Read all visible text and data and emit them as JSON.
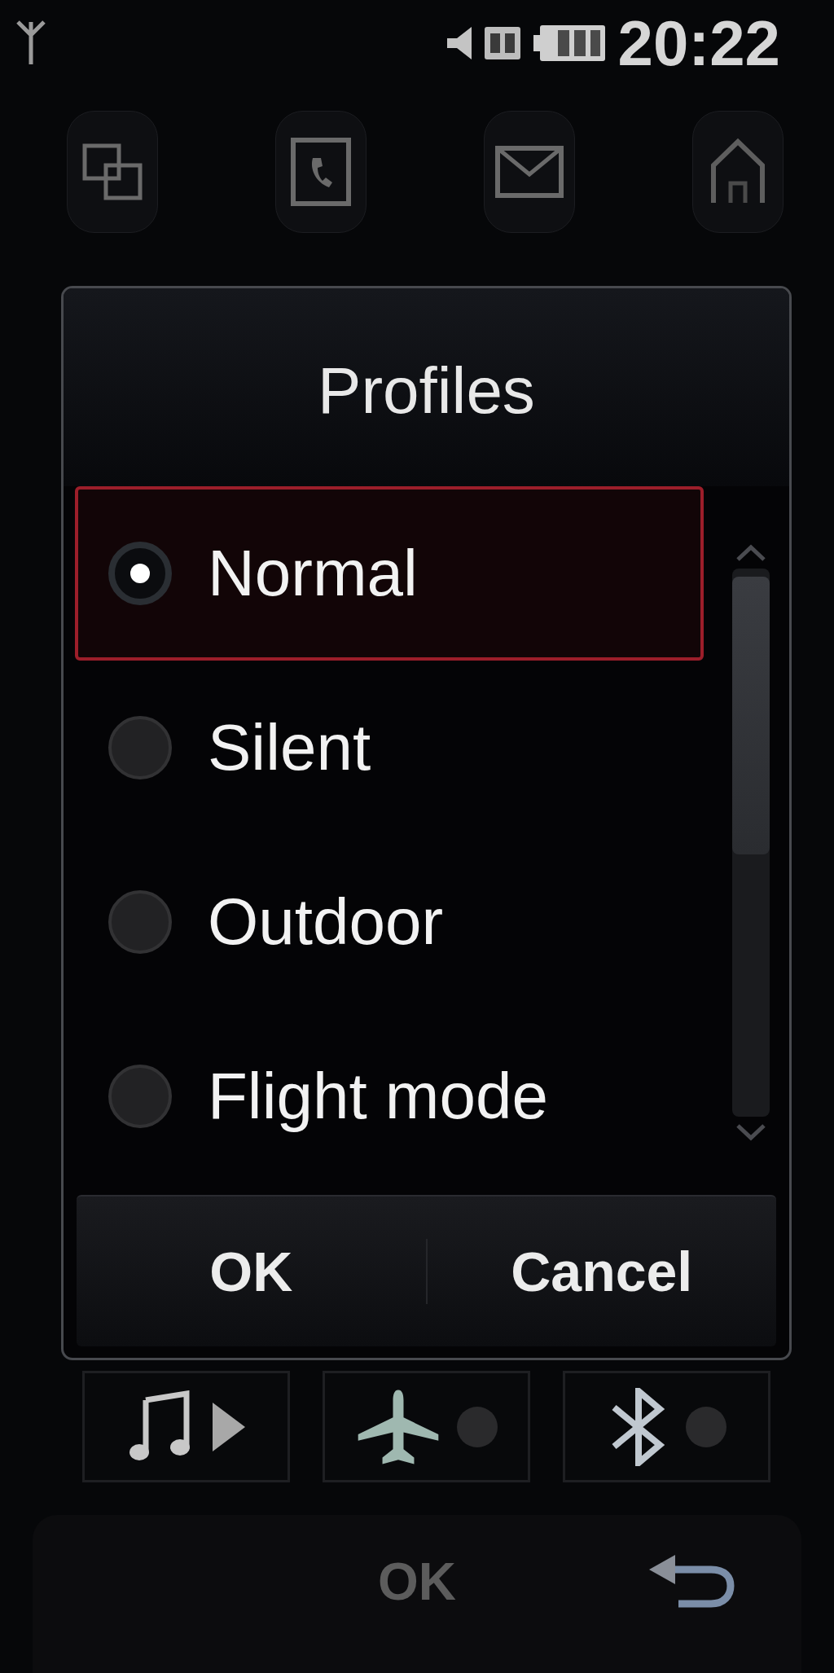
{
  "status_bar": {
    "time": "20:22"
  },
  "dialog": {
    "title": "Profiles",
    "options": [
      {
        "label": "Normal",
        "selected": true
      },
      {
        "label": "Silent",
        "selected": false
      },
      {
        "label": "Outdoor",
        "selected": false
      },
      {
        "label": "Flight mode",
        "selected": false
      }
    ],
    "buttons": [
      "OK",
      "Cancel"
    ]
  },
  "quick_toggles": [
    {
      "kind": "music"
    },
    {
      "kind": "flight",
      "on": false
    },
    {
      "kind": "bluetooth",
      "on": false
    }
  ],
  "soft_keys": {
    "center": "OK"
  }
}
